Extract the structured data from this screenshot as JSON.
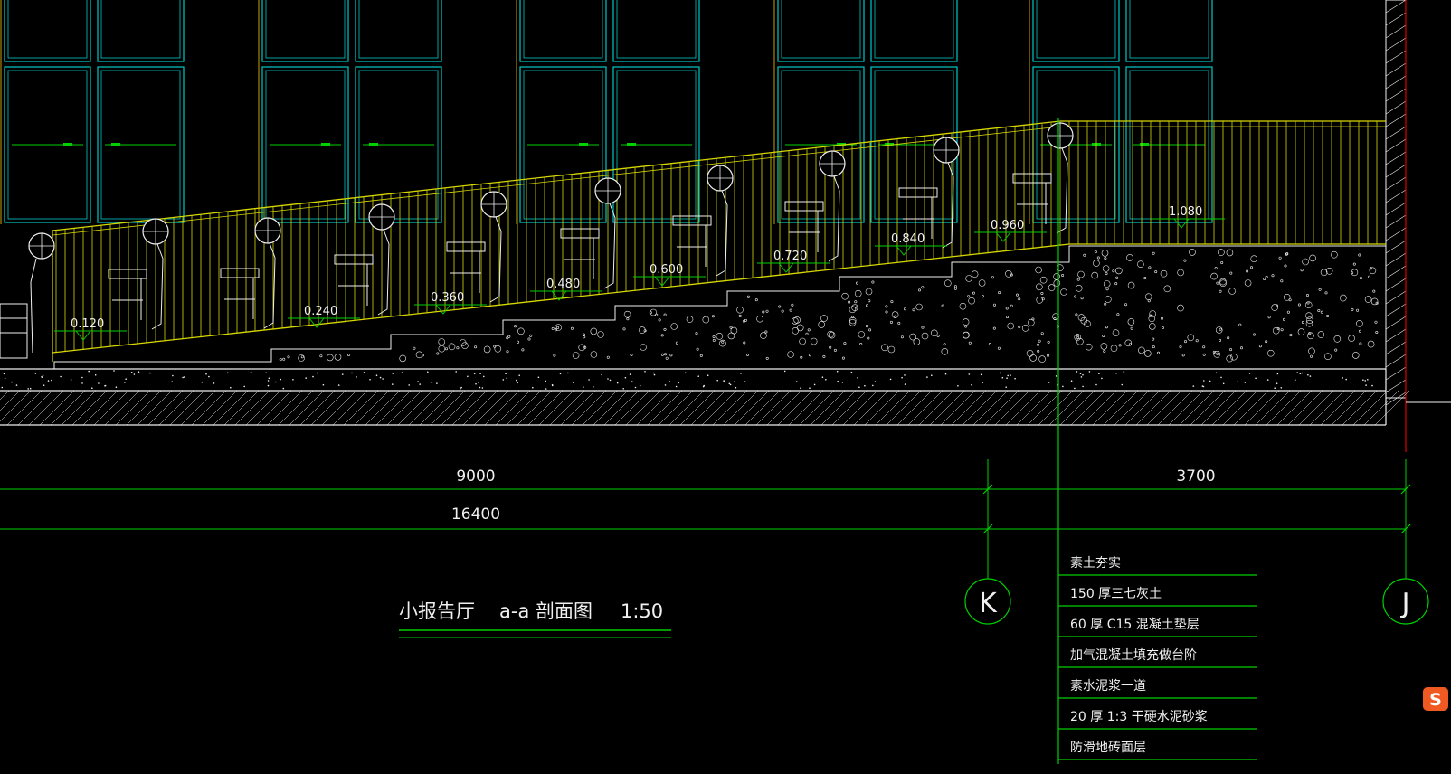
{
  "drawing": {
    "title": "小报告厅",
    "section": "a-a 剖面图",
    "scale": "1:50"
  },
  "dimensions": {
    "span_left": "9000",
    "span_right": "3700",
    "span_total": "16400"
  },
  "axes": {
    "left": "K",
    "right": "J"
  },
  "elevations": [
    "0.120",
    "0.240",
    "0.360",
    "0.480",
    "0.600",
    "0.720",
    "0.840",
    "0.960",
    "1.080"
  ],
  "layers": [
    "素土夯实",
    "150 厚三七灰土",
    "60 厚 C15 混凝土垫层",
    "加气混凝土填充做台阶",
    "素水泥浆一道",
    "20 厚 1:3 干硬水泥砂浆",
    "防滑地砖面层"
  ],
  "tray_icon": "S",
  "colors": {
    "background": "#000000",
    "window": "#00c8c8",
    "railing": "#d7d700",
    "dimension": "#00d000",
    "white": "#f0f0f0",
    "red": "#e00000"
  }
}
